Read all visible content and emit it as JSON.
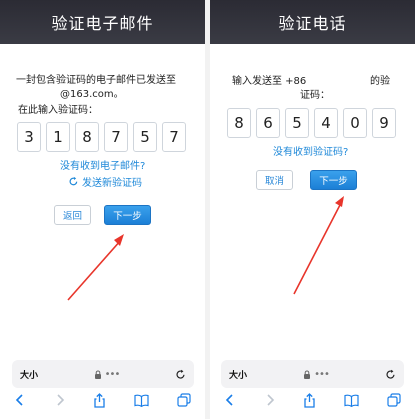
{
  "email_panel": {
    "title": "验证电子邮件",
    "desc_line1": "一封包含验证码的电子邮件已发送至",
    "desc_line2": "@163.com。",
    "input_label": "在此输入验证码：",
    "code_digits": [
      "3",
      "1",
      "8",
      "7",
      "5",
      "7"
    ],
    "not_received_link": "没有收到电子邮件?",
    "resend_link": "发送新验证码",
    "back_button": "返回",
    "next_button": "下一步",
    "address_bar": {
      "text_size": "大小",
      "url_dots": "•••"
    }
  },
  "phone_panel": {
    "title": "验证电话",
    "desc_line1_a": "输入发送至 +86",
    "desc_line1_b": "的验",
    "desc_line2": "证码：",
    "code_digits": [
      "8",
      "6",
      "5",
      "4",
      "0",
      "9"
    ],
    "not_received_link": "没有收到验证码?",
    "cancel_button": "取消",
    "next_button": "下一步",
    "address_bar": {
      "text_size": "大小",
      "url_dots": "•••"
    }
  },
  "colors": {
    "header_bg": "#33343d",
    "link": "#1e88d8",
    "primary_button": "#2a8ee0",
    "arrow": "#e8352b"
  },
  "icons": {
    "refresh": "refresh-icon",
    "lock": "lock-icon",
    "reload": "reload-icon",
    "back": "chevron-left-icon",
    "forward": "chevron-right-icon",
    "share": "share-icon",
    "bookmarks": "book-icon",
    "tabs": "tabs-icon"
  }
}
